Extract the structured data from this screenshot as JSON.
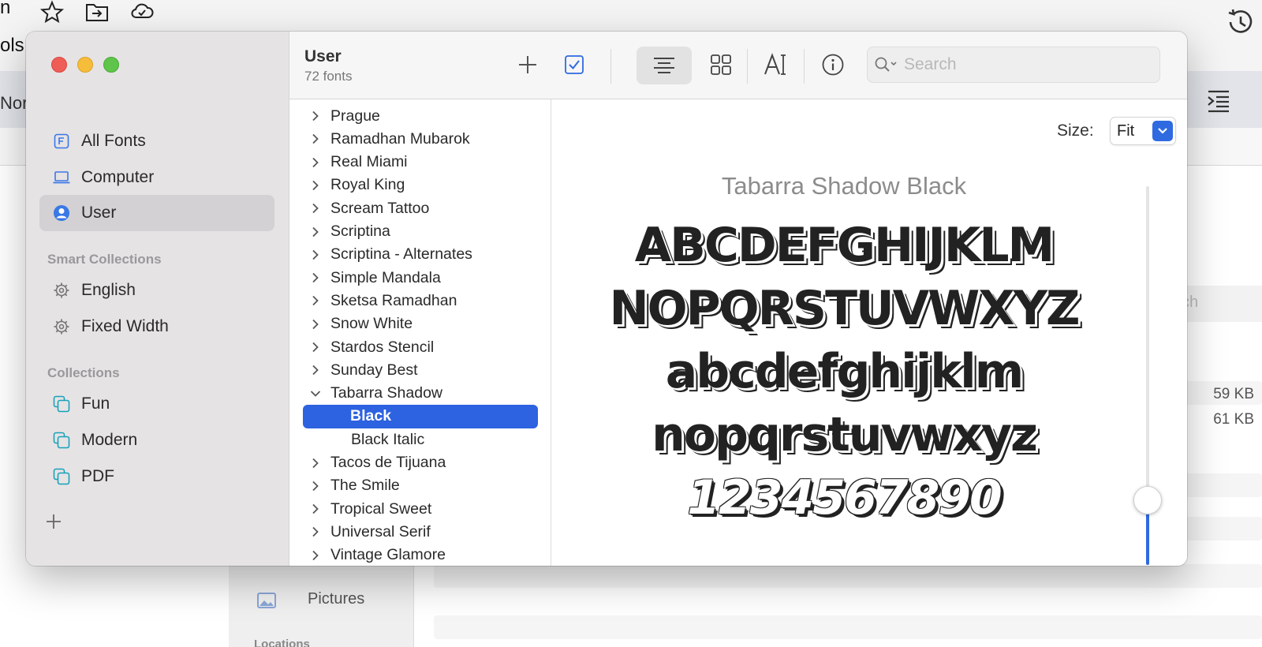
{
  "background": {
    "title_fragment": "n",
    "tools_fragment": "ols",
    "style_fragment": "Nor",
    "finder": {
      "sidebar_item": "Pictures",
      "sidebar_heading": "Locations",
      "search_fragment": "ch",
      "sizes": [
        "59 KB",
        "61 KB"
      ]
    }
  },
  "window": {
    "sidebar": {
      "library": [
        {
          "label": "All Fonts",
          "icon": "font-f-icon"
        },
        {
          "label": "Computer",
          "icon": "laptop-icon"
        },
        {
          "label": "User",
          "icon": "person-circle-icon",
          "selected": true
        }
      ],
      "smart_heading": "Smart Collections",
      "smart": [
        {
          "label": "English",
          "icon": "gear-icon"
        },
        {
          "label": "Fixed Width",
          "icon": "gear-icon"
        }
      ],
      "collections_heading": "Collections",
      "collections": [
        {
          "label": "Fun",
          "icon": "collection-icon"
        },
        {
          "label": "Modern",
          "icon": "collection-icon"
        },
        {
          "label": "PDF",
          "icon": "collection-icon"
        }
      ]
    },
    "toolbar": {
      "title": "User",
      "subtitle": "72 fonts",
      "search_placeholder": "Search"
    },
    "font_list": [
      {
        "name": "Prague",
        "type": "family",
        "expanded": false
      },
      {
        "name": "Ramadhan Mubarok",
        "type": "family",
        "expanded": false
      },
      {
        "name": "Real Miami",
        "type": "family",
        "expanded": false
      },
      {
        "name": "Royal King",
        "type": "family",
        "expanded": false
      },
      {
        "name": "Scream Tattoo",
        "type": "family",
        "expanded": false
      },
      {
        "name": "Scriptina",
        "type": "family",
        "expanded": false
      },
      {
        "name": "Scriptina - Alternates",
        "type": "family",
        "expanded": false
      },
      {
        "name": "Simple Mandala",
        "type": "family",
        "expanded": false
      },
      {
        "name": "Sketsa Ramadhan",
        "type": "family",
        "expanded": false
      },
      {
        "name": "Snow White",
        "type": "family",
        "expanded": false
      },
      {
        "name": "Stardos Stencil",
        "type": "family",
        "expanded": false
      },
      {
        "name": "Sunday Best",
        "type": "family",
        "expanded": false
      },
      {
        "name": "Tabarra Shadow",
        "type": "family",
        "expanded": true
      },
      {
        "name": "Black",
        "type": "face",
        "selected": true
      },
      {
        "name": "Black Italic",
        "type": "face"
      },
      {
        "name": "Tacos de Tijuana",
        "type": "family",
        "expanded": false
      },
      {
        "name": "The Smile",
        "type": "family",
        "expanded": false
      },
      {
        "name": "Tropical Sweet",
        "type": "family",
        "expanded": false
      },
      {
        "name": "Universal Serif",
        "type": "family",
        "expanded": false
      },
      {
        "name": "Vintage Glamore",
        "type": "family",
        "expanded": false
      }
    ],
    "preview": {
      "size_label": "Size:",
      "size_value": "Fit",
      "font_name": "Tabarra Shadow Black",
      "lines": [
        "ABCDEFGHIJKLM",
        "NOPQRSTUVWXYZ",
        "abcdefghijklm",
        "nopqrstuvwxyz",
        "1234567890"
      ],
      "size_slider_fraction": 0.17
    }
  }
}
